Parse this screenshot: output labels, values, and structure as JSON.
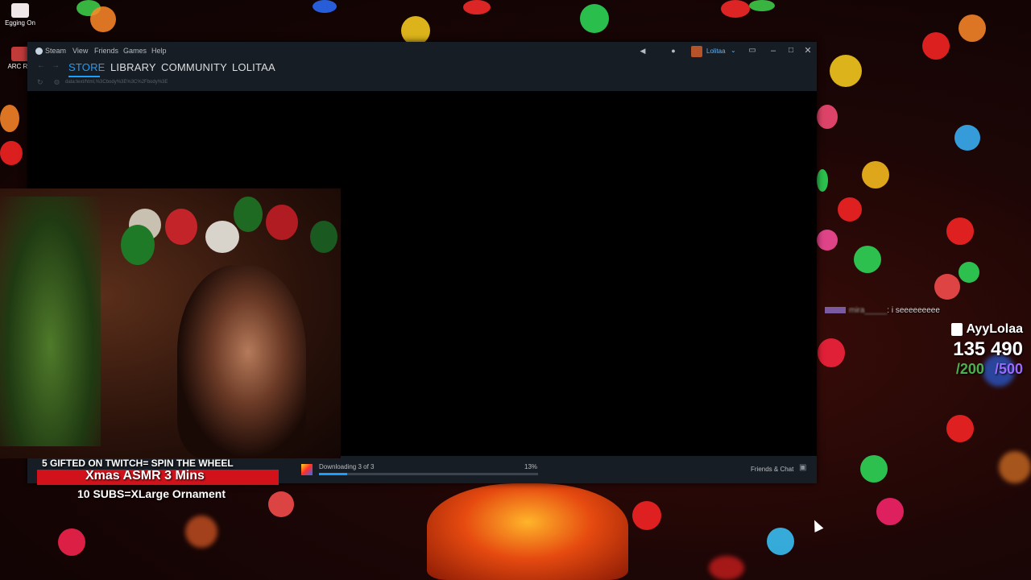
{
  "desktop": {
    "icons": [
      {
        "label": "Egging On"
      },
      {
        "label": "ARC Rai"
      }
    ]
  },
  "steam": {
    "menu": [
      "Steam",
      "View",
      "Friends",
      "Games",
      "Help"
    ],
    "user_name": "Lolitaa",
    "tabs": [
      "STORE",
      "LIBRARY",
      "COMMUNITY",
      "LOLITAA"
    ],
    "active_tab": "STORE",
    "url": "data:text/html,%3Cbody%3E%3C%2Fbody%3E",
    "download": {
      "status_text": "Downloading 3 of 3",
      "percent_text": "13%",
      "progress": 0.13
    },
    "friends_chat_label": "Friends & Chat"
  },
  "overlay": {
    "gifted_text": "5 GIFTED ON TWITCH= SPIN THE WHEEL",
    "xmas_text": "Xmas ASMR 3 Mins",
    "subs_text": "10 SUBS=XLarge Ornament",
    "chat_message": ": i seeeeeeeee",
    "channel_name": "AyyLolaa",
    "total_count": "135 490",
    "goal_one": "/200",
    "goal_two": "/500"
  },
  "colors": {
    "steam_accent": "#1a9fff",
    "banner_red": "#d1121b",
    "goal_green": "#4caf50",
    "goal_purple": "#9b6bff"
  }
}
